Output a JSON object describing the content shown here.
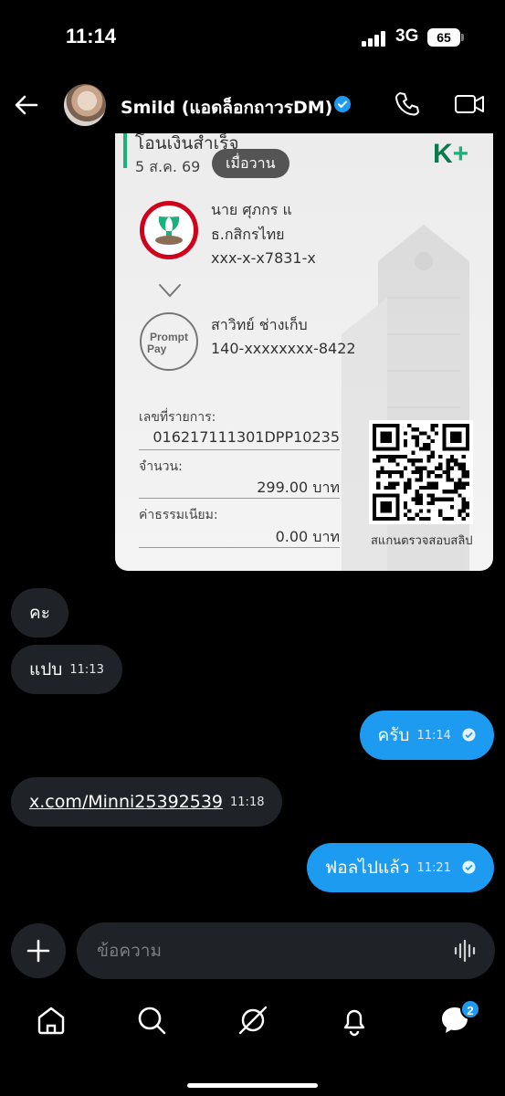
{
  "status_bar": {
    "time": "11:14",
    "network": "3G",
    "battery": "65"
  },
  "header": {
    "contact_name": "Smild (แอดล็อกถาวรDM)",
    "icons": [
      "back-arrow-icon",
      "verified-badge-icon",
      "phone-icon",
      "video-icon"
    ]
  },
  "receipt": {
    "title": "โอนเงินสำเร็จ",
    "date": "5 ส.ค. 69",
    "brand": "K",
    "brand_plus": "+",
    "sender": {
      "name": "นาย ศุภกร แ",
      "bank": "ธ.กสิกรไทย",
      "account": "xxx-x-x7831-x"
    },
    "receiver": {
      "logo_line1": "Prompt",
      "logo_line2": "Pay",
      "name": "สาวิทย์ ช่างเก็บ",
      "account": "140-xxxxxxxx-8422"
    },
    "ref_label": "เลขที่รายการ:",
    "ref_value": "016217111301DPP10235",
    "amount_label": "จำนวน:",
    "amount_value": "299.00 บาท",
    "fee_label": "ค่าธรรมเนียม:",
    "fee_value": "0.00 บาท",
    "qr_label": "สแกนตรวจสอบสลิป"
  },
  "date_pill": "เมื่อวาน",
  "messages": [
    {
      "dir": "in",
      "text": "คะ",
      "time": ""
    },
    {
      "dir": "in",
      "text": "แปบ",
      "time": "11:13"
    },
    {
      "dir": "out",
      "text": "ครับ",
      "time": "11:14"
    },
    {
      "dir": "in",
      "text": "x.com/Minni25392539",
      "time": "11:18"
    },
    {
      "dir": "out",
      "text": "ฟอลไปแล้ว",
      "time": "11:21"
    }
  ],
  "composer": {
    "placeholder": "ข้อความ"
  },
  "nav": {
    "items": [
      "home-icon",
      "search-icon",
      "grok-icon",
      "notifications-icon",
      "messages-icon"
    ],
    "messages_badge": "2"
  },
  "colors": {
    "accent": "#1d9bf0",
    "incoming_bubble": "#1f2226",
    "background": "#000000",
    "kbank_green": "#1bb17b"
  }
}
